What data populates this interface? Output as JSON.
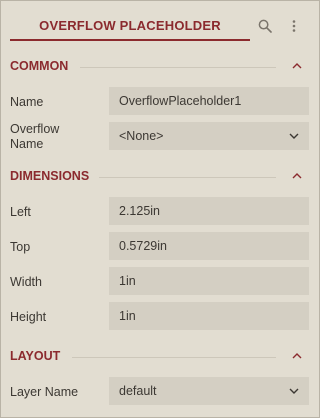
{
  "header": {
    "title": "OVERFLOW PLACEHOLDER"
  },
  "sections": {
    "common": {
      "title": "COMMON",
      "name_label": "Name",
      "name_value": "OverflowPlaceholder1",
      "overflow_label_line1": "Overflow",
      "overflow_label_line2": "Name",
      "overflow_value": "<None>"
    },
    "dimensions": {
      "title": "DIMENSIONS",
      "left_label": "Left",
      "left_value": "2.125in",
      "top_label": "Top",
      "top_value": "0.5729in",
      "width_label": "Width",
      "width_value": "1in",
      "height_label": "Height",
      "height_value": "1in"
    },
    "layout": {
      "title": "LAYOUT",
      "layer_label": "Layer Name",
      "layer_value": "default"
    }
  },
  "colors": {
    "accent": "#8b2a2e",
    "background": "#e2ddd1",
    "field_background": "#d4cfc3",
    "text": "#3c3833"
  },
  "icons": [
    "search-icon",
    "more-vertical-icon",
    "chevron-up-icon",
    "chevron-down-icon"
  ]
}
